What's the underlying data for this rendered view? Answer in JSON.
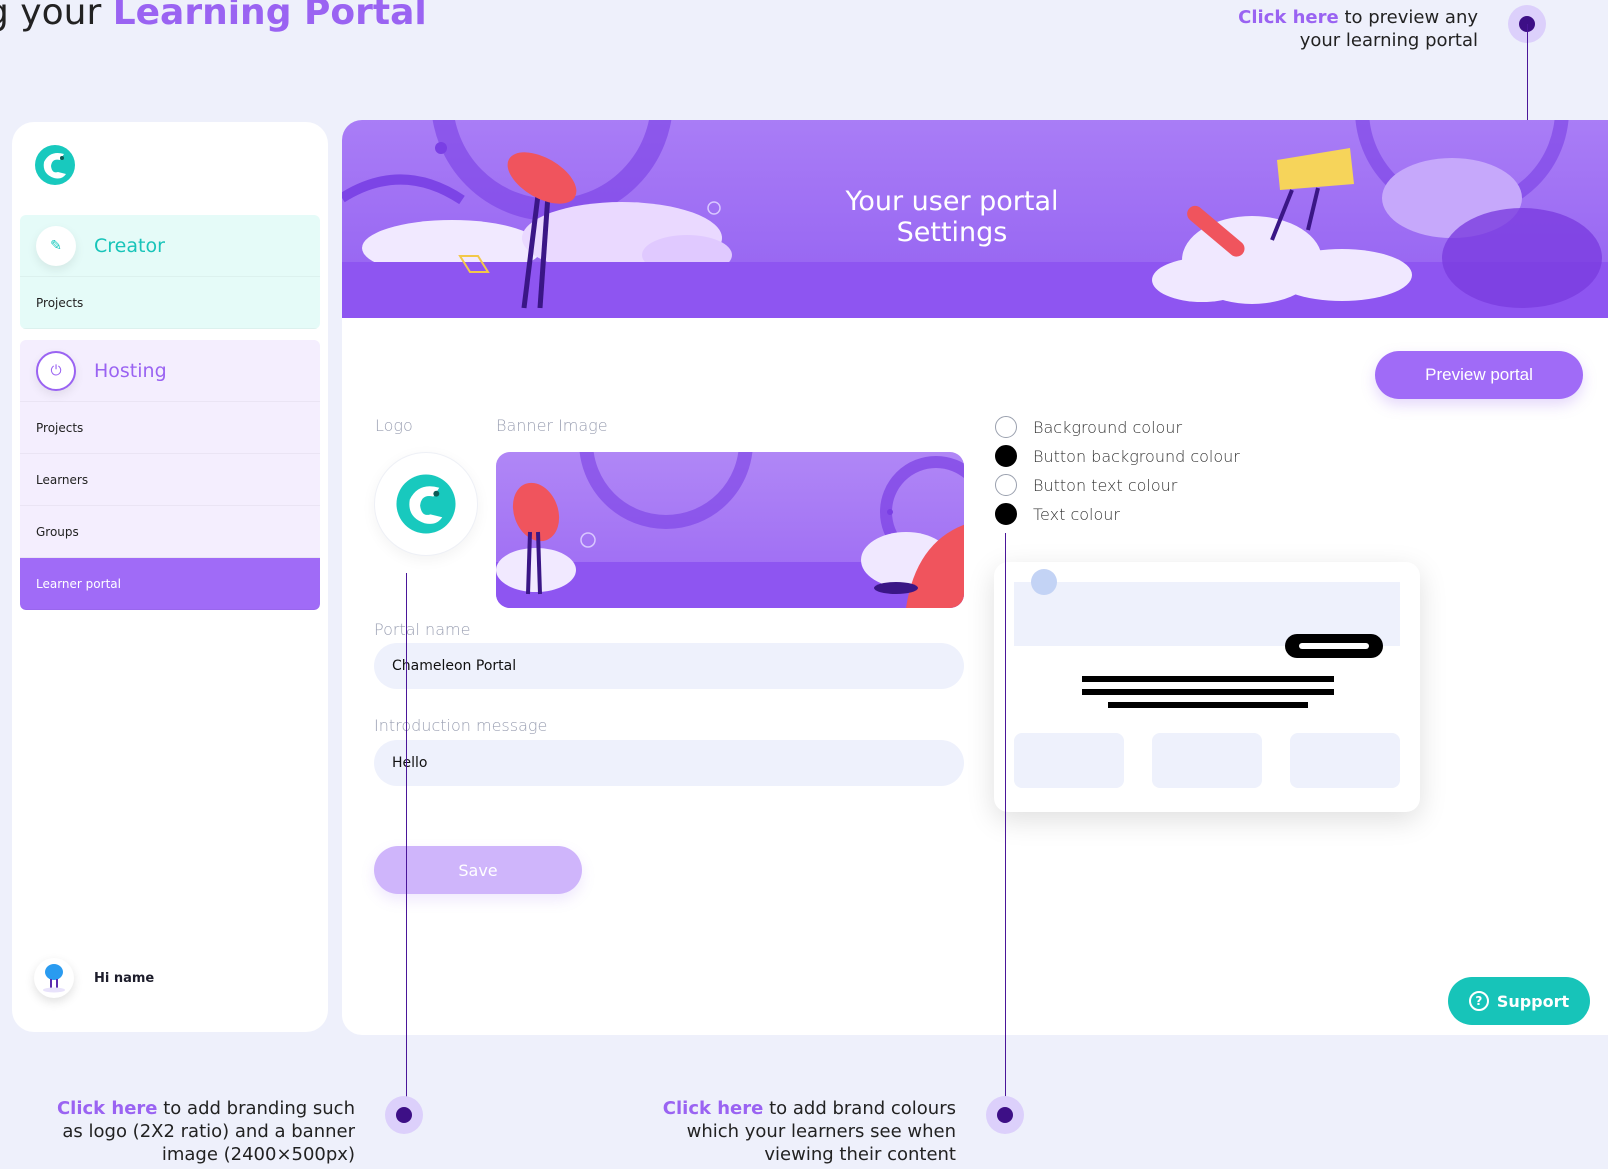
{
  "header": {
    "title_prefix": "g your ",
    "title_accent": "Learning Portal"
  },
  "callouts": {
    "preview": {
      "link": "Click here",
      "text": " to preview any",
      "line2": "your learning portal"
    },
    "branding": {
      "link": "Click here",
      "text": " to add branding such",
      "line2": "as logo (2X2 ratio) and a banner",
      "line3": "image (2400×500px)"
    },
    "colours": {
      "link": "Click here",
      "text": " to add brand colours",
      "line2": "which your learners see when",
      "line3": "viewing their content"
    }
  },
  "sidebar": {
    "creator": {
      "title": "Creator",
      "items": [
        "Projects"
      ]
    },
    "hosting": {
      "title": "Hosting",
      "items": [
        "Projects",
        "Learners",
        "Groups",
        "Learner portal"
      ]
    },
    "user": {
      "greeting": "Hi name"
    }
  },
  "banner": {
    "title_line1": "Your user portal",
    "title_line2": "Settings"
  },
  "toolbar": {
    "preview_label": "Preview portal",
    "save_label": "Save",
    "support_label": "Support"
  },
  "form": {
    "logo_label": "Logo",
    "banner_label": "Banner Image",
    "portal_name_label": "Portal name",
    "portal_name_value": "Chameleon Portal",
    "intro_label": "Introduction message",
    "intro_value": "Hello"
  },
  "colours": {
    "options": [
      {
        "label": "Background colour",
        "selected": false
      },
      {
        "label": "Button background colour",
        "selected": true
      },
      {
        "label": "Button text colour",
        "selected": false
      },
      {
        "label": "Text colour",
        "selected": true
      }
    ]
  },
  "theme": {
    "accent": "#9a63f2",
    "teal": "#17c4b9",
    "dark_dot": "#3d0f86"
  }
}
